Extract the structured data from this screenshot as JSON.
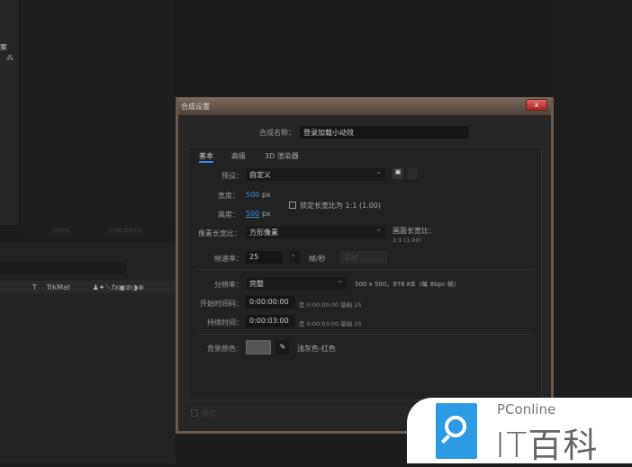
{
  "background": {
    "left_label": "案",
    "zoom": "100%",
    "timecode": "0:00:00:00",
    "layer_mode": "T",
    "trkmat": "TrkMat"
  },
  "dialog": {
    "title": "合成设置",
    "close": "x",
    "name_label": "合成名称：",
    "name_value": "登录加载小动效",
    "tabs": [
      "基本",
      "高级",
      "3D 渲染器"
    ],
    "preset_label": "预设：",
    "preset_value": "自定义",
    "width_label": "宽度：",
    "width_value": "500",
    "height_label": "高度：",
    "height_value": "500",
    "unit": "px",
    "lock_label": "锁定长宽比为 1:1 (1.00)",
    "par_label": "像素长宽比：",
    "par_value": "方形像素",
    "frame_ar_label": "画面长宽比：",
    "frame_ar_value": "1:1 (1.00)",
    "fps_label": "帧速率：",
    "fps_value": "25",
    "fps_unit": "帧/秒",
    "drop_frame": "丢帧",
    "res_label": "分辨率：",
    "res_value": "完整",
    "res_info": "500 x 500，976 KB（每 8bpc 帧）",
    "start_label": "开始时间码：",
    "start_value": "0:00:00:00",
    "start_info": "是 0:00:00:00  基础 25",
    "dur_label": "持续时间：",
    "dur_value": "0:00:03:00",
    "dur_info": "是 0:00:03:00  基础 25",
    "bg_label": "背景颜色：",
    "bg_name": "浅灰色-红色",
    "bg_color": "#555555",
    "preview_label": "预览"
  },
  "watermark": {
    "brand": "PConline",
    "name": "IT百科"
  }
}
